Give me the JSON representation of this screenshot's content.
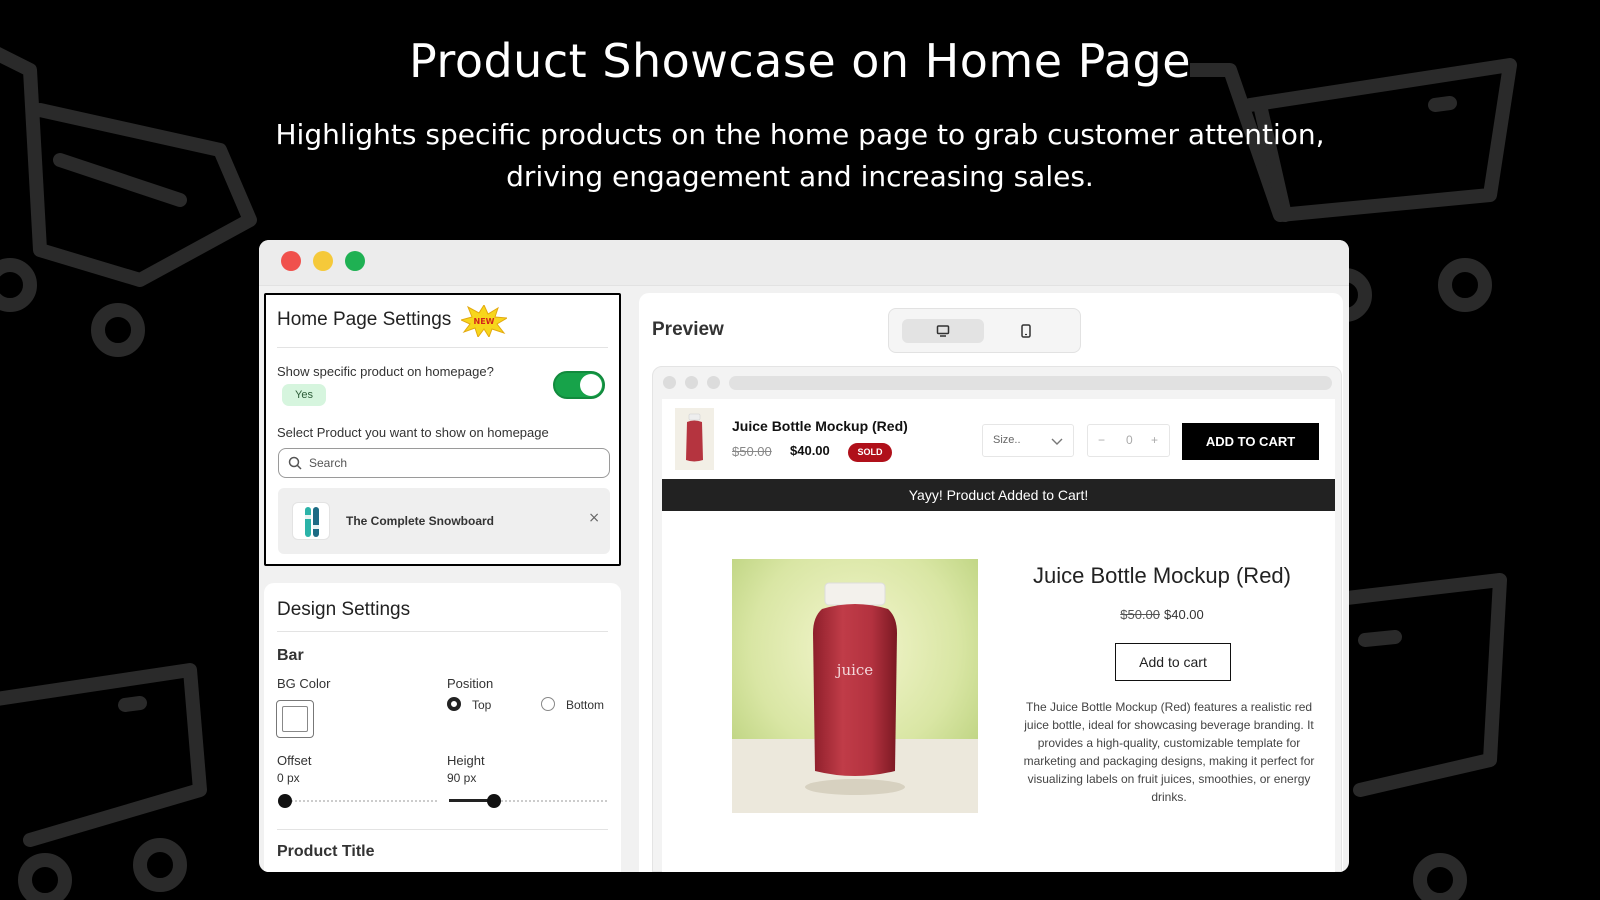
{
  "hero": {
    "title": "Product Showcase on Home Page",
    "subtitle": "Highlights specific products on the home page to grab customer attention, driving engagement and increasing sales."
  },
  "window": {
    "controls": [
      "close-dot",
      "minimize-dot",
      "maximize-dot"
    ],
    "colors": {
      "close": "#f0514c",
      "minimize": "#f5c93a",
      "maximize": "#1fb153"
    }
  },
  "home_settings": {
    "title": "Home Page Settings",
    "badge": "NEW",
    "toggle_label": "Show specific product on homepage?",
    "toggle_value": "Yes",
    "toggle_on": true,
    "select_label": "Select Product you want to show on homepage",
    "search_placeholder": "Search",
    "selected_product": "The Complete Snowboard",
    "remove_icon": "×"
  },
  "design_settings": {
    "title": "Design Settings",
    "section": "Bar",
    "bg_color_label": "BG Color",
    "bg_color": "#ffffff",
    "position_label": "Position",
    "position_options": [
      "Top",
      "Bottom"
    ],
    "position_selected": "Top",
    "offset_label": "Offset",
    "offset_value": "0 px",
    "height_label": "Height",
    "height_value": "90 px",
    "product_title_label": "Product Title"
  },
  "preview": {
    "title": "Preview",
    "devices": [
      "desktop-icon",
      "mobile-icon"
    ],
    "active_device": "desktop-icon",
    "bar": {
      "product_name": "Juice Bottle Mockup (Red)",
      "old_price": "$50.00",
      "price": "$40.00",
      "badge": "SOLD",
      "size_placeholder": "Size..",
      "qty_minus": "−",
      "qty_value": "0",
      "qty_plus": "+",
      "add_button": "ADD TO CART"
    },
    "notice": "Yayy! Product Added to Cart!",
    "showcase": {
      "title": "Juice Bottle Mockup (Red)",
      "old_price": "$50.00",
      "price": "$40.00",
      "button": "Add to cart",
      "bottle_label": "juice",
      "description": "The Juice Bottle Mockup (Red) features a realistic red juice bottle, ideal for showcasing beverage branding. It provides a high-quality, customizable template for marketing and packaging designs, making it perfect for visualizing labels on fruit juices, smoothies, or energy drinks."
    }
  },
  "colors": {
    "background": "#000000",
    "toggle_on": "#17a34a",
    "sold_badge": "#b0101a",
    "notice_bar": "#222222",
    "bottle": "#b5343f"
  }
}
